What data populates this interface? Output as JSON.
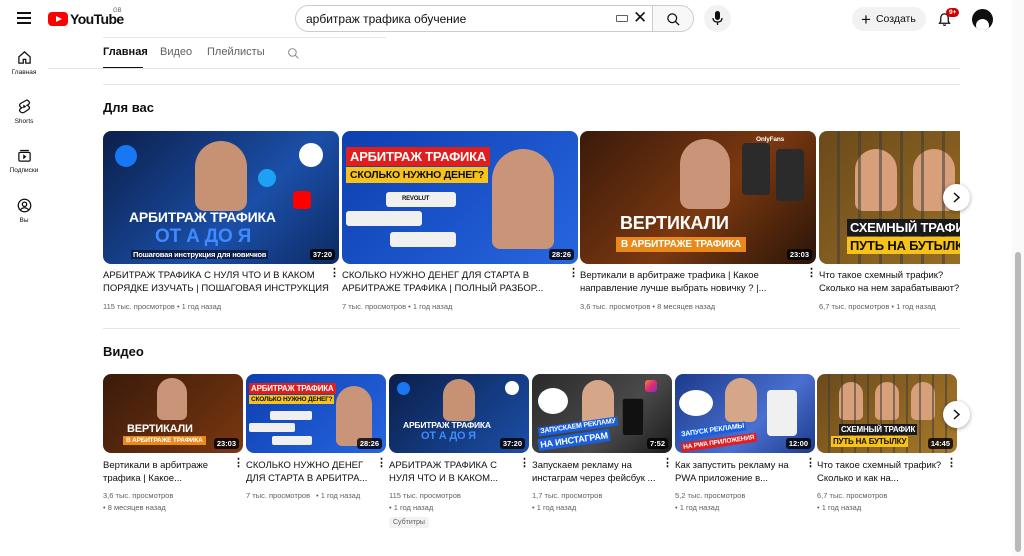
{
  "header": {
    "logo_text": "YouTube",
    "region": "GB",
    "search_value": "арбитраж трафика обучение",
    "create_label": "Создать",
    "notifications_badge": "9+"
  },
  "sidebar": {
    "items": [
      {
        "label": "Главная",
        "icon": "home-icon"
      },
      {
        "label": "Shorts",
        "icon": "shorts-icon"
      },
      {
        "label": "Подписки",
        "icon": "subscriptions-icon"
      },
      {
        "label": "Вы",
        "icon": "you-icon"
      }
    ]
  },
  "tabs": [
    "Главная",
    "Видео",
    "Плейлисты"
  ],
  "sections": {
    "for_you": {
      "title": "Для вас",
      "videos": [
        {
          "title": "АРБИТРАЖ ТРАФИКА С НУЛЯ ЧТО И В КАКОМ ПОРЯДКЕ ИЗУЧАТЬ | ПОШАГОВАЯ ИНСТРУКЦИЯ",
          "meta": "115 тыс. просмотров • 1 год назад",
          "duration": "37:20",
          "thumb_big": "АРБИТРАЖ ТРАФИКА",
          "thumb_mid": "ОТ А ДО Я",
          "thumb_small": "Пошаговая инструкция для новичков"
        },
        {
          "title": "СКОЛЬКО НУЖНО ДЕНЕГ ДЛЯ СТАРТА В АРБИТРАЖЕ ТРАФИКА | ПОЛНЫЙ РАЗБОР...",
          "meta": "7 тыс. просмотров • 1 год назад",
          "duration": "28:26",
          "thumb_big": "АРБИТРАЖ ТРАФИКА",
          "thumb_mid": "СКОЛЬКО НУЖНО ДЕНЕГ?",
          "thumb_small": "REVOLUT"
        },
        {
          "title": "Вертикали в арбитраже трафика | Какое направление лучше выбрать новичку ? |...",
          "meta": "3,6 тыс. просмотров • 8 месяцев назад",
          "duration": "23:03",
          "thumb_big": "ВЕРТИКАЛИ",
          "thumb_mid": "В АРБИТРАЖЕ ТРАФИКА",
          "thumb_small": "OnlyFans"
        },
        {
          "title": "Что такое схемный трафик? Сколько на нем зарабатывают? | Арбитраж...",
          "meta": "6,7 тыс. просмотров • 1 год назад",
          "duration": "",
          "thumb_big": "СХЕМНЫЙ ТРАФИК",
          "thumb_mid": "ПУТЬ НА БУТЫЛКУ",
          "thumb_small": ""
        }
      ]
    },
    "videos": {
      "title": "Видео",
      "videos": [
        {
          "title": "Вертикали в арбитраже трафика | Какое...",
          "meta1": "3,6 тыс. просмотров",
          "meta2": "• 8 месяцев назад",
          "duration": "23:03",
          "thumb_big": "ВЕРТИКАЛИ",
          "thumb_mid": "В АРБИТРАЖЕ ТРАФИКА",
          "badge": ""
        },
        {
          "title": "СКОЛЬКО НУЖНО ДЕНЕГ ДЛЯ СТАРТА В АРБИТРА...",
          "meta1": "7 тыс. просмотров",
          "meta2": "• 1 год назад",
          "duration": "28:26",
          "thumb_big": "АРБИТРАЖ ТРАФИКА",
          "thumb_mid": "СКОЛЬКО НУЖНО ДЕНЕГ?",
          "badge": ""
        },
        {
          "title": "АРБИТРАЖ ТРАФИКА С НУЛЯ ЧТО И В КАКОМ...",
          "meta1": "115 тыс. просмотров",
          "meta2": "• 1 год назад",
          "duration": "37:20",
          "thumb_big": "АРБИТРАЖ ТРАФИКА",
          "thumb_mid": "ОТ А ДО Я",
          "badge": "Субтитры"
        },
        {
          "title": "Запускаем рекламу на инстаграм через фейсбук ...",
          "meta1": "1,7 тыс. просмотров",
          "meta2": "• 1 год назад",
          "duration": "7:52",
          "thumb_big": "ЗАПУСКАЕМ РЕКЛАМУ",
          "thumb_mid": "НА ИНСТАГРАМ",
          "badge": ""
        },
        {
          "title": "Как запустить рекламу на PWA приложение в...",
          "meta1": "5,2 тыс. просмотров",
          "meta2": "• 1 год назад",
          "duration": "12:00",
          "thumb_big": "ЗАПУСК РЕКЛАМЫ",
          "thumb_mid": "НА PWA ПРИЛОЖЕНИЯ",
          "badge": ""
        },
        {
          "title": "Что такое схемный трафик? Сколько и как на...",
          "meta1": "6,7 тыс. просмотров",
          "meta2": "• 1 год назад",
          "duration": "14:45",
          "thumb_big": "СХЕМНЫЙ ТРАФИК",
          "thumb_mid": "ПУТЬ НА БУТЫЛКУ",
          "badge": ""
        }
      ]
    }
  },
  "colors": {
    "brand_red": "#ff0000",
    "badge_red": "#cc0000",
    "accent_blue": "#1e5bd8",
    "accent_orange": "#f7a21b",
    "text_primary": "#0f0f0f",
    "text_secondary": "#606060"
  }
}
